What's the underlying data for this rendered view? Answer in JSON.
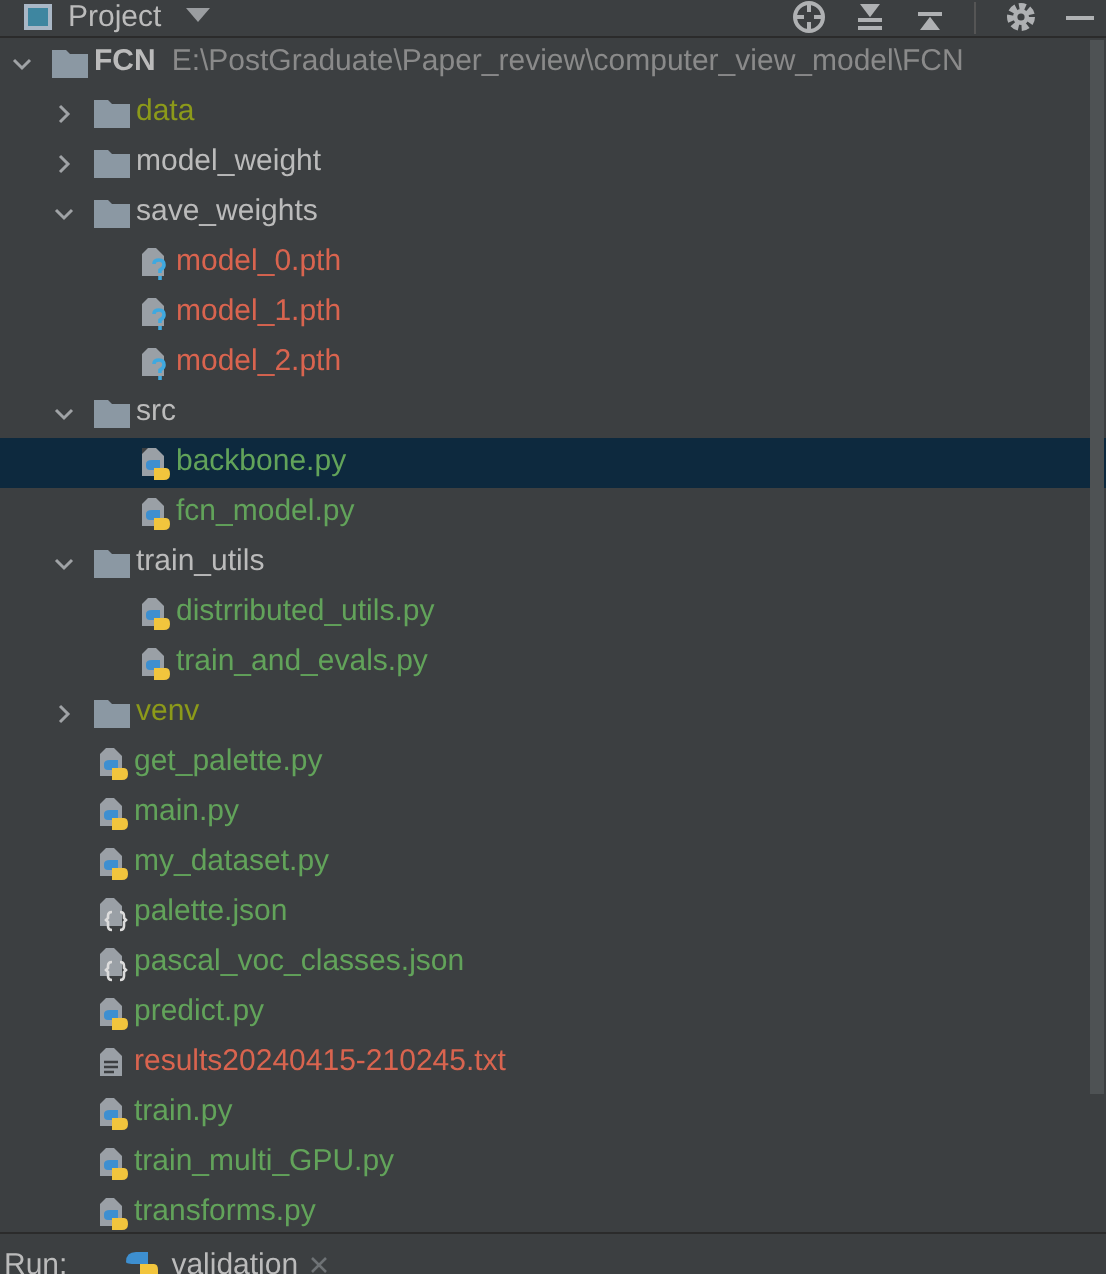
{
  "panel": {
    "title": "Project"
  },
  "root": {
    "name": "FCN",
    "path": "E:\\PostGraduate\\Paper_review\\computer_view_model\\FCN",
    "expanded": true,
    "selected": false
  },
  "tree": [
    {
      "name": "data",
      "kind": "folder",
      "expanded": false,
      "selected": false,
      "color": "#8c9a1a"
    },
    {
      "name": "model_weight",
      "kind": "folder",
      "expanded": false,
      "selected": false,
      "color": "#bbbbbb"
    },
    {
      "name": "save_weights",
      "kind": "folder",
      "expanded": true,
      "selected": false,
      "color": "#bbbbbb",
      "children": [
        {
          "name": "model_0.pth",
          "kind": "unknown",
          "selected": false,
          "color": "#d9644f"
        },
        {
          "name": "model_1.pth",
          "kind": "unknown",
          "selected": false,
          "color": "#d9644f"
        },
        {
          "name": "model_2.pth",
          "kind": "unknown",
          "selected": false,
          "color": "#d9644f"
        }
      ]
    },
    {
      "name": "src",
      "kind": "folder",
      "expanded": true,
      "selected": false,
      "color": "#bbbbbb",
      "children": [
        {
          "name": "backbone.py",
          "kind": "python",
          "selected": true,
          "color": "#62a35a"
        },
        {
          "name": "fcn_model.py",
          "kind": "python",
          "selected": false,
          "color": "#62a35a"
        }
      ]
    },
    {
      "name": "train_utils",
      "kind": "folder",
      "expanded": true,
      "selected": false,
      "color": "#bbbbbb",
      "children": [
        {
          "name": "distrributed_utils.py",
          "kind": "python",
          "selected": false,
          "color": "#62a35a"
        },
        {
          "name": "train_and_evals.py",
          "kind": "python",
          "selected": false,
          "color": "#62a35a"
        }
      ]
    },
    {
      "name": "venv",
      "kind": "folder",
      "expanded": false,
      "selected": false,
      "color": "#8c9a1a"
    },
    {
      "name": "get_palette.py",
      "kind": "python",
      "selected": false,
      "color": "#62a35a"
    },
    {
      "name": "main.py",
      "kind": "python",
      "selected": false,
      "color": "#62a35a"
    },
    {
      "name": "my_dataset.py",
      "kind": "python",
      "selected": false,
      "color": "#62a35a"
    },
    {
      "name": "palette.json",
      "kind": "json",
      "selected": false,
      "color": "#62a35a"
    },
    {
      "name": "pascal_voc_classes.json",
      "kind": "json",
      "selected": false,
      "color": "#62a35a"
    },
    {
      "name": "predict.py",
      "kind": "python",
      "selected": false,
      "color": "#62a35a"
    },
    {
      "name": "results20240415-210245.txt",
      "kind": "text",
      "selected": false,
      "color": "#d9644f"
    },
    {
      "name": "train.py",
      "kind": "python",
      "selected": false,
      "color": "#62a35a"
    },
    {
      "name": "train_multi_GPU.py",
      "kind": "python",
      "selected": false,
      "color": "#62a35a"
    },
    {
      "name": "transforms.py",
      "kind": "python",
      "selected": false,
      "color": "#62a35a"
    }
  ],
  "run_bar": {
    "label": "Run:",
    "tabs": [
      {
        "label": "validation",
        "selected": true
      }
    ]
  }
}
